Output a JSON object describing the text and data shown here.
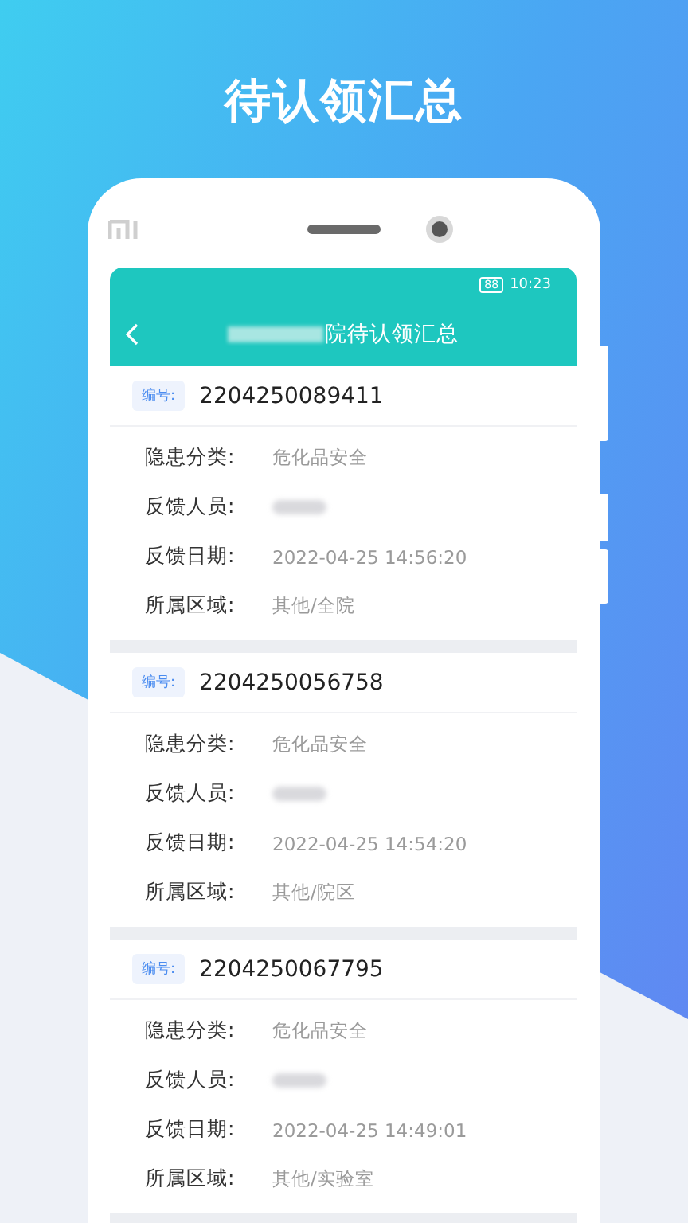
{
  "headline": "待认领汇总",
  "status_bar": {
    "battery": "88",
    "time": "10:23"
  },
  "nav": {
    "title": "院待认领汇总",
    "title_redacted": true
  },
  "records": [
    {
      "id_label": "编号:",
      "id": "2204250089411",
      "fields": [
        {
          "kind": "text",
          "label": "隐患分类:",
          "value": "危化品安全"
        },
        {
          "kind": "redacted",
          "label": "反馈人员:"
        },
        {
          "kind": "text",
          "label": "反馈日期:",
          "value": "2022-04-25 14:56:20"
        },
        {
          "kind": "text",
          "label": "所属区域:",
          "value": "其他/全院"
        }
      ]
    },
    {
      "id_label": "编号:",
      "id": "2204250056758",
      "fields": [
        {
          "kind": "text",
          "label": "隐患分类:",
          "value": "危化品安全"
        },
        {
          "kind": "redacted",
          "label": "反馈人员:"
        },
        {
          "kind": "text",
          "label": "反馈日期:",
          "value": "2022-04-25 14:54:20"
        },
        {
          "kind": "text",
          "label": "所属区域:",
          "value": "其他/院区"
        }
      ]
    },
    {
      "id_label": "编号:",
      "id": "2204250067795",
      "fields": [
        {
          "kind": "text",
          "label": "隐患分类:",
          "value": "危化品安全"
        },
        {
          "kind": "redacted",
          "label": "反馈人员:"
        },
        {
          "kind": "text",
          "label": "反馈日期:",
          "value": "2022-04-25 14:49:01"
        },
        {
          "kind": "text",
          "label": "所属区域:",
          "value": "其他/实验室"
        }
      ]
    }
  ]
}
